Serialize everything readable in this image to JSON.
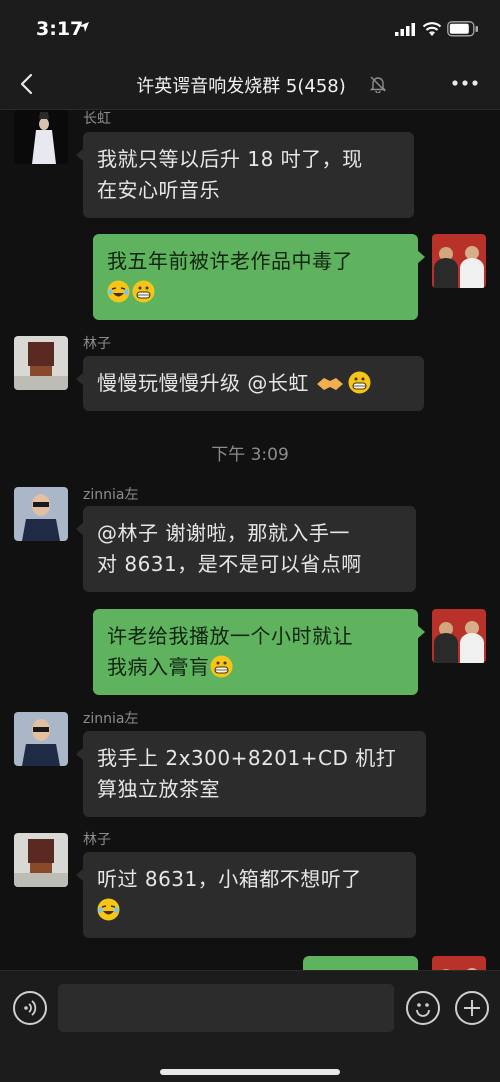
{
  "status": {
    "time": "3:17"
  },
  "nav": {
    "title": "许英谔音响发烧群 5(458)"
  },
  "chat": {
    "timestamp": "下午 3:09",
    "messages": [
      {
        "sender": "长虹",
        "line1": "我就只等以后升 18 吋了，现",
        "line2": "在安心听音乐"
      },
      {
        "line1": "我五年前被许老作品中毒了"
      },
      {
        "sender": "林子",
        "line1": "慢慢玩慢慢升级 @长虹 "
      },
      {
        "sender": "zinnia左",
        "line1": "@林子 谢谢啦，那就入手一",
        "line2": "对 8631，是不是可以省点啊"
      },
      {
        "line1": "许老给我播放一个小时就让",
        "line2": "我病入膏肓"
      },
      {
        "sender": "zinnia左",
        "line1": "我手上 2x300+8201+CD 机打",
        "line2": "算独立放茶室"
      },
      {
        "sender": "林子",
        "line1": "听过 8631，小箱都不想听了"
      }
    ]
  },
  "icons": {
    "back": "chevron-left-icon",
    "mute": "bell-slash-icon",
    "more": "more-dots-icon",
    "voice": "voice-icon",
    "emoji": "smiley-icon",
    "plus": "plus-icon"
  },
  "colors": {
    "background": "#111111",
    "incoming_bubble": "#2c2c2c",
    "outgoing_bubble": "#5fb35f"
  }
}
